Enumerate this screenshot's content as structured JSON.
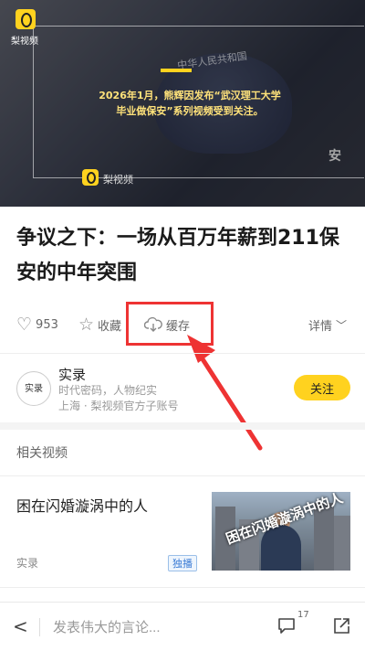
{
  "video": {
    "brand": "梨视频",
    "caption_line1": "2026年1月，熊辉因发布“武汉理工大学",
    "caption_line2": "毕业做保安”系列视频受到关注。",
    "badge_text": "中华人民共和国",
    "badge_char": "安",
    "watermark": "梨视频"
  },
  "article": {
    "title": "争议之下：一场从百万年薪到211保安的中年突围"
  },
  "actions": {
    "like_count": "953",
    "collect_label": "收藏",
    "cache_label": "缓存",
    "details_label": "详情"
  },
  "channel": {
    "avatar_text": "实录",
    "name": "实录",
    "desc": "时代密码，人物纪实",
    "location": "上海 · 梨视频官方子账号",
    "follow_label": "关注"
  },
  "related": {
    "heading": "相关视频",
    "items": [
      {
        "title": "困在闪婚漩涡中的人",
        "source": "实录",
        "tag": "独播",
        "thumb_text": "困在闪婚漩涡中的人"
      }
    ]
  },
  "bottom": {
    "comment_placeholder": "发表伟大的言论...",
    "comment_count": "17"
  },
  "colors": {
    "accent": "#ffd21f",
    "highlight": "#e33333"
  }
}
